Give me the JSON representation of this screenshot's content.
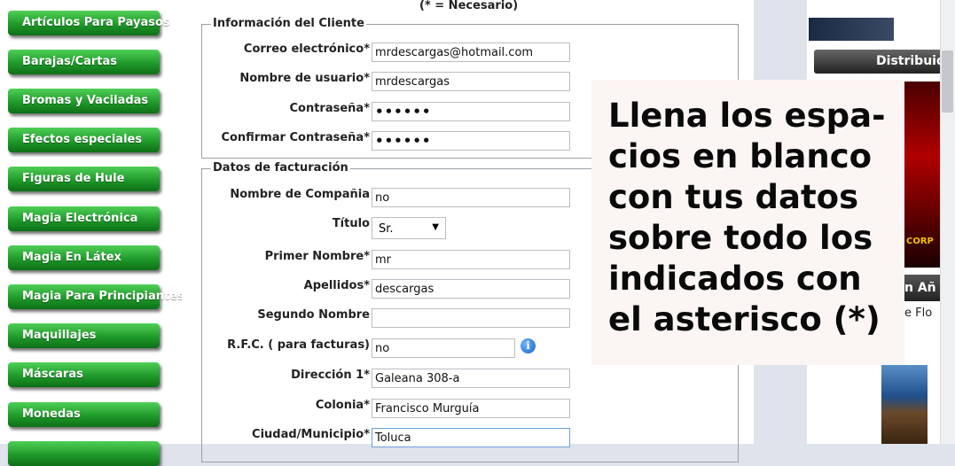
{
  "sidebar": {
    "items": [
      {
        "label": "Artículos Para Payasos"
      },
      {
        "label": "Barajas/Cartas"
      },
      {
        "label": "Bromas y Vaciladas"
      },
      {
        "label": "Efectos especiales"
      },
      {
        "label": "Figuras de Hule"
      },
      {
        "label": "Magia Electrónica"
      },
      {
        "label": "Magia En Látex"
      },
      {
        "label": "Magia Para Principiantes"
      },
      {
        "label": "Maquillajes"
      },
      {
        "label": "Máscaras"
      },
      {
        "label": "Monedas"
      }
    ]
  },
  "form": {
    "required_note": "(* = Necesario)",
    "client_section": {
      "legend": "Información del Cliente",
      "email_label": "Correo electrónico*",
      "email_value": "mrdescargas@hotmail.com",
      "username_label": "Nombre de usuario*",
      "username_value": "mrdescargas",
      "password_label": "Contraseña*",
      "password_value": "••••••",
      "confirm_label": "Confirmar Contraseña*",
      "confirm_value": "••••••"
    },
    "billing_section": {
      "legend": "Datos de facturación",
      "company_label": "Nombre de Compañia",
      "company_value": "no",
      "title_label": "Título",
      "title_value": "Sr.",
      "first_name_label": "Primer Nombre*",
      "first_name_value": "mr",
      "last_name_label": "Apellidos*",
      "last_name_value": "descargas",
      "second_name_label": "Segundo Nombre",
      "second_name_value": "",
      "rfc_label": "R.F.C. ( para facturas)",
      "rfc_value": "no",
      "address_label": "Dirección 1*",
      "address_value": "Galeana 308-a",
      "colonia_label": "Colonia*",
      "colonia_value": "Francisco Murguía",
      "city_label": "Ciudad/Municipio*",
      "city_value": "Toluca"
    }
  },
  "right_column": {
    "banner_title": "Distribuid",
    "fragment_1": "n Añ",
    "fragment_2": "e Flo",
    "logo_text": "CORP"
  },
  "overlay": {
    "lines": [
      "Llena los espa-",
      "cios en blanco",
      "con tus datos",
      "sobre todo los",
      "indicados con",
      "el asterisco (*)"
    ]
  },
  "colors": {
    "sidebar_button": "#1f9a2a",
    "overlay_bg": "#fbf5f4",
    "info_icon": "#1765c7"
  }
}
